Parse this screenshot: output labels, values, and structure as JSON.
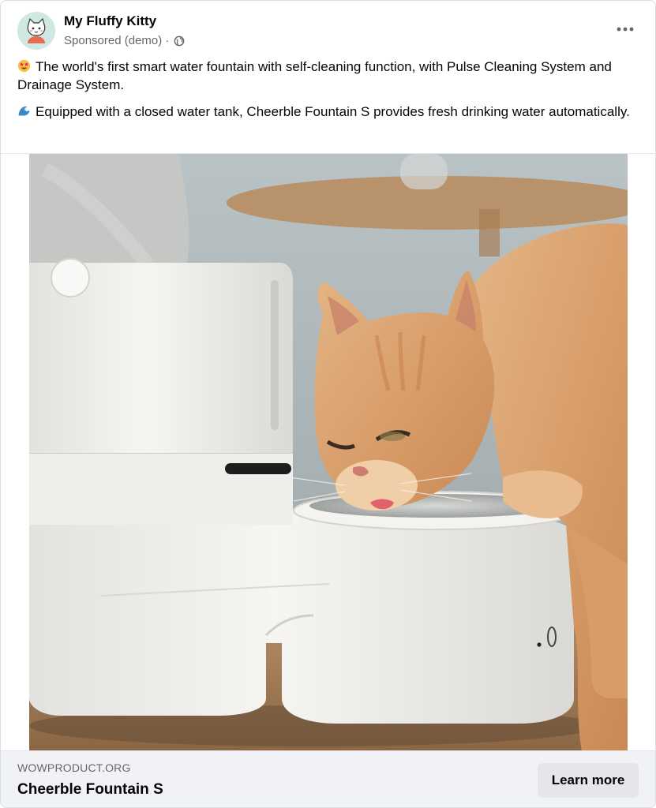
{
  "post": {
    "page_name": "My Fluffy Kitty",
    "sponsored_label": "Sponsored (demo)",
    "separator": "·",
    "avatar_icon": "cat-mascot-icon",
    "privacy_icon": "globe-icon",
    "more_icon": "more-options-icon",
    "paragraphs": [
      {
        "emoji": "star-struck-emoji",
        "text": "The world's first smart water fountain with self-cleaning function, with Pulse Cleaning System and Drainage System."
      },
      {
        "emoji": "water-wave-emoji",
        "text": "Equipped with a closed water tank, Cheerble Fountain S provides fresh drinking water automatically."
      }
    ]
  },
  "media": {
    "image_alt": "Orange cat drinking from a white Cheerble Fountain S water fountain"
  },
  "cta": {
    "domain": "WOWPRODUCT.ORG",
    "product_title": "Cheerble Fountain S",
    "button_label": "Learn more"
  },
  "colors": {
    "text_primary": "#050505",
    "text_secondary": "#65676b",
    "footer_bg": "#f0f2f5",
    "button_bg": "#e4e6eb",
    "avatar_bg": "#cfe8e2",
    "cat_orange": "#d9a371",
    "fountain_white": "#f2f1ee"
  }
}
